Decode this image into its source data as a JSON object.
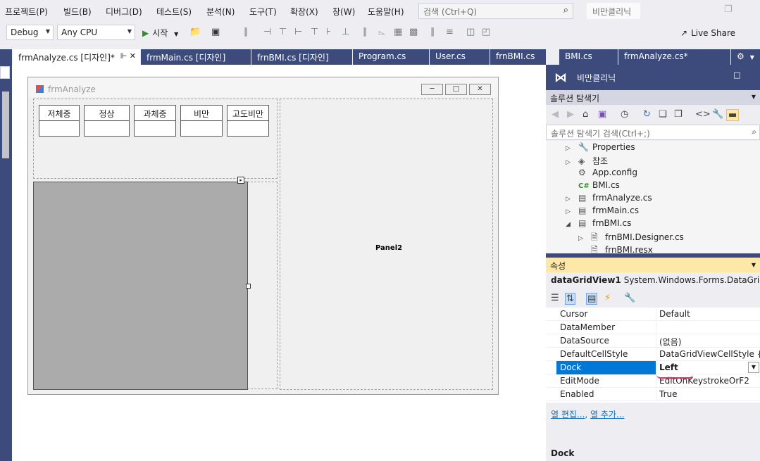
{
  "menu": {
    "items": [
      "프로젝트(P)",
      "빌드(B)",
      "디버그(D)",
      "테스트(S)",
      "분석(N)",
      "도구(T)",
      "확장(X)",
      "창(W)",
      "도움말(H)"
    ],
    "search_placeholder": "검색 (Ctrl+Q)",
    "solution_name": "비만클리닉"
  },
  "toolbar": {
    "config": "Debug",
    "platform": "Any CPU",
    "start": "시작",
    "live_share": "Live Share"
  },
  "tabs": [
    {
      "label": "frmAnalyze.cs [디자인]*",
      "active": true
    },
    {
      "label": "frmMain.cs [디자인]",
      "active": false
    },
    {
      "label": "frnBMI.cs [디자인]",
      "active": false
    },
    {
      "label": "Program.cs",
      "active": false
    },
    {
      "label": "User.cs",
      "active": false
    },
    {
      "label": "frnBMI.cs",
      "active": false
    },
    {
      "label": "BMI.cs",
      "active": false
    },
    {
      "label": "frmAnalyze.cs*",
      "active": false
    }
  ],
  "form": {
    "title": "frmAnalyze",
    "categories": [
      "저체중",
      "정상",
      "과체중",
      "비만",
      "고도비만"
    ],
    "panel2_label": "Panel2"
  },
  "solution_explorer": {
    "project_name": "비만클리닉",
    "title": "솔루션 탐색기",
    "search_placeholder": "솔루션 탐색기 검색(Ctrl+;)",
    "tree": [
      {
        "label": "Properties",
        "icon": "wrench-icon",
        "expander": "▷",
        "indent": 0
      },
      {
        "label": "참조",
        "icon": "references-icon",
        "expander": "▷",
        "indent": 0
      },
      {
        "label": "App.config",
        "icon": "config-icon",
        "expander": "",
        "indent": 0
      },
      {
        "label": "BMI.cs",
        "icon": "csharp-icon",
        "expander": "",
        "indent": 0
      },
      {
        "label": "frmAnalyze.cs",
        "icon": "form-icon",
        "expander": "▷",
        "indent": 0
      },
      {
        "label": "frmMain.cs",
        "icon": "form-icon",
        "expander": "▷",
        "indent": 0
      },
      {
        "label": "frnBMI.cs",
        "icon": "form-icon",
        "expander": "◢",
        "indent": 0
      },
      {
        "label": "frnBMI.Designer.cs",
        "icon": "csharp-file-icon",
        "expander": "▷",
        "indent": 1
      },
      {
        "label": "frnBMI.resx",
        "icon": "resx-icon",
        "expander": "",
        "indent": 1
      }
    ]
  },
  "properties": {
    "title": "속성",
    "object_name": "dataGridView1",
    "object_type": "System.Windows.Forms.DataGridView",
    "rows": [
      {
        "name": "Cursor",
        "value": "Default"
      },
      {
        "name": "DataMember",
        "value": ""
      },
      {
        "name": "DataSource",
        "value": "(없음)"
      },
      {
        "name": "DefaultCellStyle",
        "value": "DataGridViewCellStyle { Ba"
      },
      {
        "name": "Dock",
        "value": "Left",
        "selected": true
      },
      {
        "name": "EditMode",
        "value": "EditOnKeystrokeOrF2"
      },
      {
        "name": "Enabled",
        "value": "True"
      }
    ],
    "link_edit_columns": "열 편집...",
    "link_add_column": "열 추가...",
    "description_title": "Dock"
  }
}
